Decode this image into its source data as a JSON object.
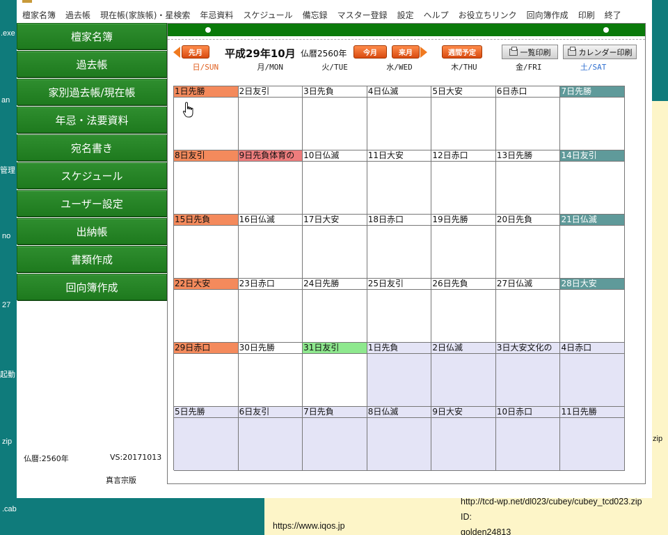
{
  "desktop": {
    "left_labels": [
      ".exe",
      "an",
      "管理",
      "no",
      "27",
      "起動",
      "zip",
      ".cab"
    ],
    "right_labels": [
      "zip"
    ],
    "notes": {
      "line1": "http://tcd-wp.net/dl023/cubey/cubey_tcd023.zip",
      "line2": "ID:",
      "line3": "golden24813",
      "line4": "https://www.iqos.jp"
    }
  },
  "menu": [
    "檀家名簿",
    "過去帳",
    "現在帳(家族帳)・星検索",
    "年忌資料",
    "スケジュール",
    "備忘録",
    "マスター登録",
    "設定",
    "ヘルプ",
    "お役立ちリンク",
    "回向簿作成",
    "印刷",
    "終了"
  ],
  "sidebar": {
    "buttons": [
      "檀家名簿",
      "過去帳",
      "家別過去帳/現在帳",
      "年忌・法要資料",
      "宛名書き",
      "スケジュール",
      "ユーザー設定",
      "出納帳",
      "書類作成",
      "回向簿作成"
    ],
    "era_label": "仏暦:2560年",
    "version": "VS:20171013",
    "edition": "真言宗版"
  },
  "calendar": {
    "title": "平成29年10月",
    "buddhist_year": "仏暦2560年",
    "prev_label": "先月",
    "today_label": "今月",
    "next_label": "来月",
    "weekly_label": "週間予定",
    "list_print": "一覧印刷",
    "calendar_print": "カレンダー印刷",
    "weekdays": [
      "日/SUN",
      "月/MON",
      "火/TUE",
      "水/WED",
      "木/THU",
      "金/FRI",
      "土/SAT"
    ],
    "weeks": [
      [
        {
          "t": "1日先勝",
          "s": "sun"
        },
        {
          "t": "2日友引",
          "s": ""
        },
        {
          "t": "3日先負",
          "s": ""
        },
        {
          "t": "4日仏滅",
          "s": ""
        },
        {
          "t": "5日大安",
          "s": ""
        },
        {
          "t": "6日赤口",
          "s": ""
        },
        {
          "t": "7日先勝",
          "s": "sat"
        }
      ],
      [
        {
          "t": "8日友引",
          "s": "sun"
        },
        {
          "t": "9日先負体育の",
          "s": "holiday"
        },
        {
          "t": "10日仏滅",
          "s": ""
        },
        {
          "t": "11日大安",
          "s": ""
        },
        {
          "t": "12日赤口",
          "s": ""
        },
        {
          "t": "13日先勝",
          "s": ""
        },
        {
          "t": "14日友引",
          "s": "sat"
        }
      ],
      [
        {
          "t": "15日先負",
          "s": "sun"
        },
        {
          "t": "16日仏滅",
          "s": ""
        },
        {
          "t": "17日大安",
          "s": ""
        },
        {
          "t": "18日赤口",
          "s": ""
        },
        {
          "t": "19日先勝",
          "s": ""
        },
        {
          "t": "20日先負",
          "s": ""
        },
        {
          "t": "21日仏滅",
          "s": "sat"
        }
      ],
      [
        {
          "t": "22日大安",
          "s": "sun"
        },
        {
          "t": "23日赤口",
          "s": ""
        },
        {
          "t": "24日先勝",
          "s": ""
        },
        {
          "t": "25日友引",
          "s": ""
        },
        {
          "t": "26日先負",
          "s": ""
        },
        {
          "t": "27日仏滅",
          "s": ""
        },
        {
          "t": "28日大安",
          "s": "sat"
        }
      ],
      [
        {
          "t": "29日赤口",
          "s": "sun"
        },
        {
          "t": "30日先勝",
          "s": ""
        },
        {
          "t": "31日友引",
          "s": "today"
        },
        {
          "t": "1日先負",
          "s": "next"
        },
        {
          "t": "2日仏滅",
          "s": "next"
        },
        {
          "t": "3日大安文化の",
          "s": "next"
        },
        {
          "t": "4日赤口",
          "s": "next"
        }
      ],
      [
        {
          "t": "5日先勝",
          "s": "next"
        },
        {
          "t": "6日友引",
          "s": "next"
        },
        {
          "t": "7日先負",
          "s": "next"
        },
        {
          "t": "8日仏滅",
          "s": "next"
        },
        {
          "t": "9日大安",
          "s": "next"
        },
        {
          "t": "10日赤口",
          "s": "next"
        },
        {
          "t": "11日先勝",
          "s": "next"
        }
      ]
    ]
  },
  "colors": {
    "sidebar_green": "#1e7a1e",
    "sunday_header": "#f48a5c",
    "saturday_header": "#5f9a9a",
    "holiday_header": "#ee7d7d",
    "today_header": "#8ee88e",
    "next_month_bg": "#e4e4f6",
    "desktop_teal": "#0f7b7b",
    "note_yellow": "#fdf5c8"
  },
  "icons": [
    "hand-pointer-icon",
    "printer-icon",
    "arrow-left-icon",
    "arrow-right-icon"
  ]
}
